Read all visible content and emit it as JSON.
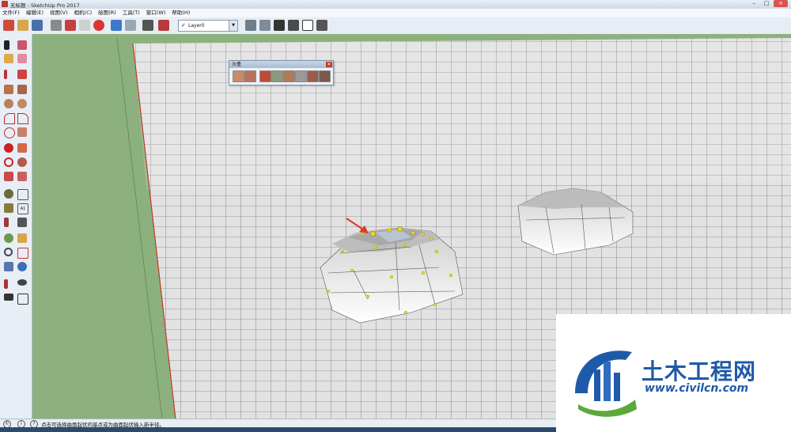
{
  "window": {
    "title": "无标题 - SketchUp Pro 2017"
  },
  "menu": [
    "文件(F)",
    "编辑(E)",
    "视图(V)",
    "相机(C)",
    "绘图(R)",
    "工具(T)",
    "窗口(W)",
    "帮助(H)"
  ],
  "layer": {
    "check": "✓",
    "name": "Layer0"
  },
  "sandbox": {
    "title": "沙盒",
    "close": "✕"
  },
  "status": {
    "hint": "点击可选择曲面起伏的基点或为曲面起伏输入新半径。"
  },
  "watermark": {
    "cn": "土木工程网",
    "en": "www.civilcn.com"
  },
  "colors": {
    "ground_green": "#8db17e",
    "grid_surface": "#e3e3e3",
    "grid_line": "#555555",
    "vertex_yellow": "#f5e400",
    "arrow_red": "#e03a2a",
    "brand_blue": "#1f5aa8"
  }
}
